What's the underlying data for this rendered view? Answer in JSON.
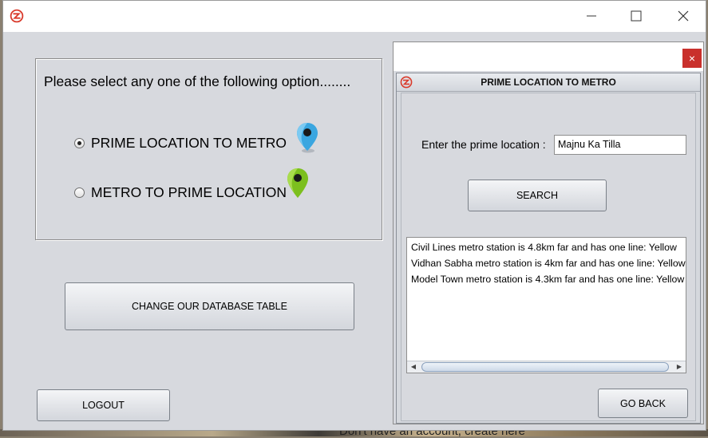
{
  "main_window": {
    "title": "",
    "prompt": "Please select any one of the following option........",
    "options": [
      {
        "label": "PRIME LOCATION TO METRO",
        "selected": true,
        "pin_icon": "blue-map-pin-icon"
      },
      {
        "label": "METRO TO PRIME LOCATION",
        "selected": false,
        "pin_icon": "green-map-pin-icon"
      }
    ],
    "change_db_label": "CHANGE OUR DATABASE TABLE",
    "logout_label": "LOGOUT"
  },
  "dialog": {
    "close_label": "×",
    "title": "PRIME LOCATION TO METRO",
    "field_label": "Enter the prime location :",
    "field_value": "Majnu Ka Tilla",
    "search_label": "SEARCH",
    "results": [
      "Civil Lines metro station is 4.8km far and has one line: Yellow",
      "Vidhan Sabha metro station is 4km far and has one line: Yellow",
      "Model Town metro station is 4.3km far and has one line: Yellow"
    ],
    "go_back_label": "GO BACK"
  },
  "background_text": "Don't have an account, create here",
  "colors": {
    "logo_red": "#d93a2b",
    "close_red": "#c9302c",
    "blue_pin": "#3aa6e0",
    "green_pin": "#7cbf1e"
  }
}
